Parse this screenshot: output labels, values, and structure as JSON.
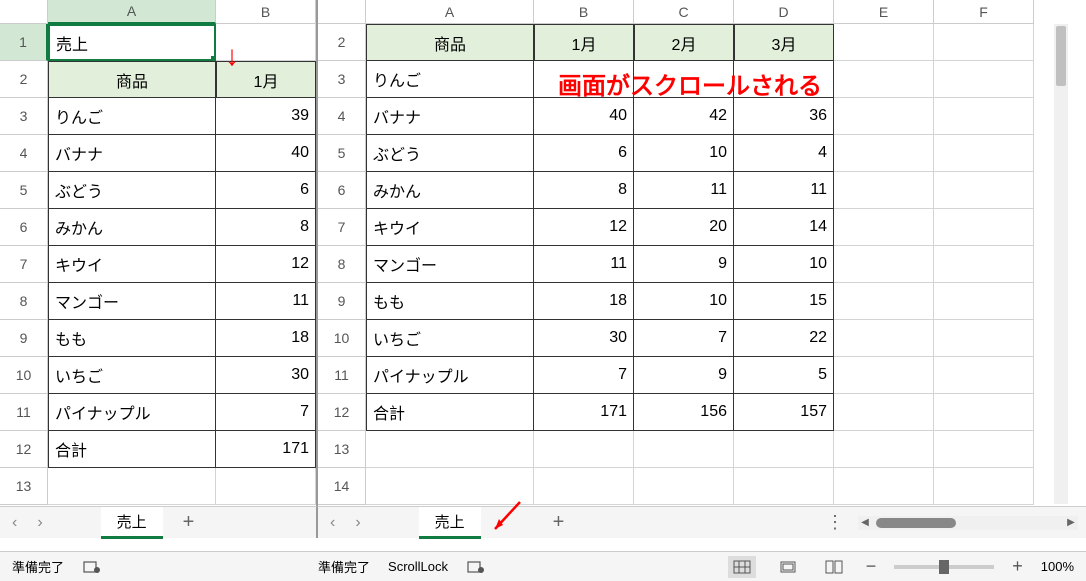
{
  "annotation_text": "画面がスクロールされる",
  "left": {
    "col_headers": [
      "A",
      "B"
    ],
    "row_headers": [
      1,
      2,
      3,
      4,
      5,
      6,
      7,
      8,
      9,
      10,
      11,
      12,
      13
    ],
    "title_cell": "売上",
    "header_row": [
      "商品",
      "1月"
    ],
    "rows": [
      [
        "りんご",
        39
      ],
      [
        "バナナ",
        40
      ],
      [
        "ぶどう",
        6
      ],
      [
        "みかん",
        8
      ],
      [
        "キウイ",
        12
      ],
      [
        "マンゴー",
        11
      ],
      [
        "もも",
        18
      ],
      [
        "いちご",
        30
      ],
      [
        "パイナップル",
        7
      ],
      [
        "合計",
        171
      ]
    ],
    "tab": "売上",
    "status": "準備完了"
  },
  "right": {
    "col_headers": [
      "A",
      "B",
      "C",
      "D",
      "E",
      "F"
    ],
    "row_headers": [
      2,
      3,
      4,
      5,
      6,
      7,
      8,
      9,
      10,
      11,
      12,
      13,
      14
    ],
    "header_row": [
      "商品",
      "1月",
      "2月",
      "3月"
    ],
    "rows": [
      [
        "りんご",
        "",
        "",
        ""
      ],
      [
        "バナナ",
        40,
        42,
        36
      ],
      [
        "ぶどう",
        6,
        10,
        4
      ],
      [
        "みかん",
        8,
        11,
        11
      ],
      [
        "キウイ",
        12,
        20,
        14
      ],
      [
        "マンゴー",
        11,
        9,
        10
      ],
      [
        "もも",
        18,
        10,
        15
      ],
      [
        "いちご",
        30,
        7,
        22
      ],
      [
        "パイナップル",
        7,
        9,
        5
      ],
      [
        "合計",
        171,
        156,
        157
      ]
    ],
    "tab": "売上",
    "status": "準備完了",
    "scroll_lock": "ScrollLock",
    "zoom": "100%"
  }
}
